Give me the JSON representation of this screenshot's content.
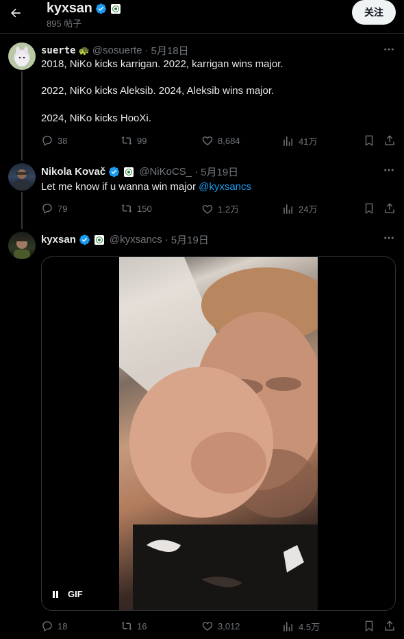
{
  "header": {
    "title": "kyxsan",
    "post_count": "895 帖子",
    "follow_label": "关注"
  },
  "colors": {
    "background": "#000000",
    "text": "#e7e9ea",
    "muted": "#71767b",
    "link": "#1d9bf0",
    "verified": "#1d9bf0",
    "divider": "#2f3336"
  },
  "posts": [
    {
      "author": "suerte",
      "emoji": "🐢",
      "handle": "@sosuerte",
      "separator": "·",
      "date": "5月18日",
      "lines": [
        "2018, NiKo kicks karrigan. 2022, karrigan wins major.",
        "2022, NiKo kicks Aleksib. 2024, Aleksib wins major.",
        "2024, NiKo kicks HooXi."
      ],
      "stats": {
        "replies": "38",
        "reposts": "99",
        "likes": "8,684",
        "views": "41万"
      }
    },
    {
      "author": "Nikola Kovač",
      "verified": true,
      "handle": "@NiKoCS_",
      "separator": "·",
      "date": "5月19日",
      "text": "Let me know if u wanna win major ",
      "mention": "@kyxsancs",
      "stats": {
        "replies": "79",
        "reposts": "150",
        "likes": "1.2万",
        "views": "24万"
      }
    },
    {
      "author": "kyxsan",
      "verified": true,
      "handle": "@kyxsancs",
      "separator": "·",
      "date": "5月19日",
      "media": {
        "type": "gif",
        "badge": "GIF",
        "state": "playing"
      },
      "stats": {
        "replies": "18",
        "reposts": "16",
        "likes": "3,012",
        "views": "4.5万"
      }
    }
  ],
  "icons": [
    "back-arrow-icon",
    "verified-icon",
    "org-badge-icon",
    "more-icon",
    "reply-icon",
    "repost-icon",
    "like-icon",
    "views-icon",
    "bookmark-icon",
    "share-icon",
    "pause-icon"
  ]
}
